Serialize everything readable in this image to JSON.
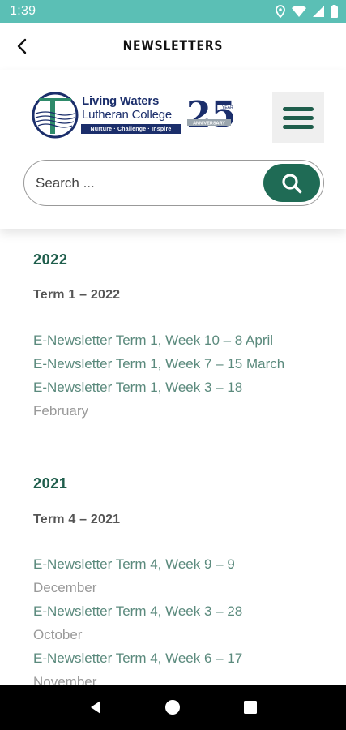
{
  "status_bar": {
    "time": "1:39",
    "icons": [
      "location-icon",
      "wifi-icon",
      "signal-icon",
      "battery-icon"
    ]
  },
  "app_bar": {
    "title": "NEWSLETTERS",
    "back_icon": "back-arrow-icon"
  },
  "header": {
    "logo": {
      "line1": "Living Waters",
      "line2": "Lutheran College",
      "tagline": "Nurture · Challenge · Inspire",
      "anniversary": "25",
      "anniversary_small": "YEAR",
      "ribbon": "ANNIVERSARY"
    },
    "menu_icon": "hamburger-menu-icon",
    "search": {
      "placeholder": "Search ...",
      "icon": "search-icon"
    }
  },
  "colors": {
    "status_bar": "#5bbfb5",
    "accent_dark_green": "#1f5e4c",
    "search_button": "#1f6b55",
    "link": "#5b8a7d",
    "navy": "#1b2e6b"
  },
  "sections": [
    {
      "year": "2022",
      "term": "Term 1 – 2022",
      "links": [
        "E-Newsletter Term 1, Week 10 – 8 April",
        "E-Newsletter Term 1, Week 7 – 15 March",
        "E-Newsletter Term 1, Week 3 – 18",
        "February"
      ]
    },
    {
      "year": "2021",
      "term": "Term 4 – 2021",
      "links": [
        "E-Newsletter Term 4, Week 9 – 9",
        "December",
        "E-Newsletter Term 4, Week 3 – 28",
        "October",
        "E-Newsletter Term 4, Week 6 – 17",
        "November"
      ]
    }
  ],
  "nav_bar": {
    "back": "nav-back-icon",
    "home": "nav-home-icon",
    "recents": "nav-recents-icon"
  }
}
